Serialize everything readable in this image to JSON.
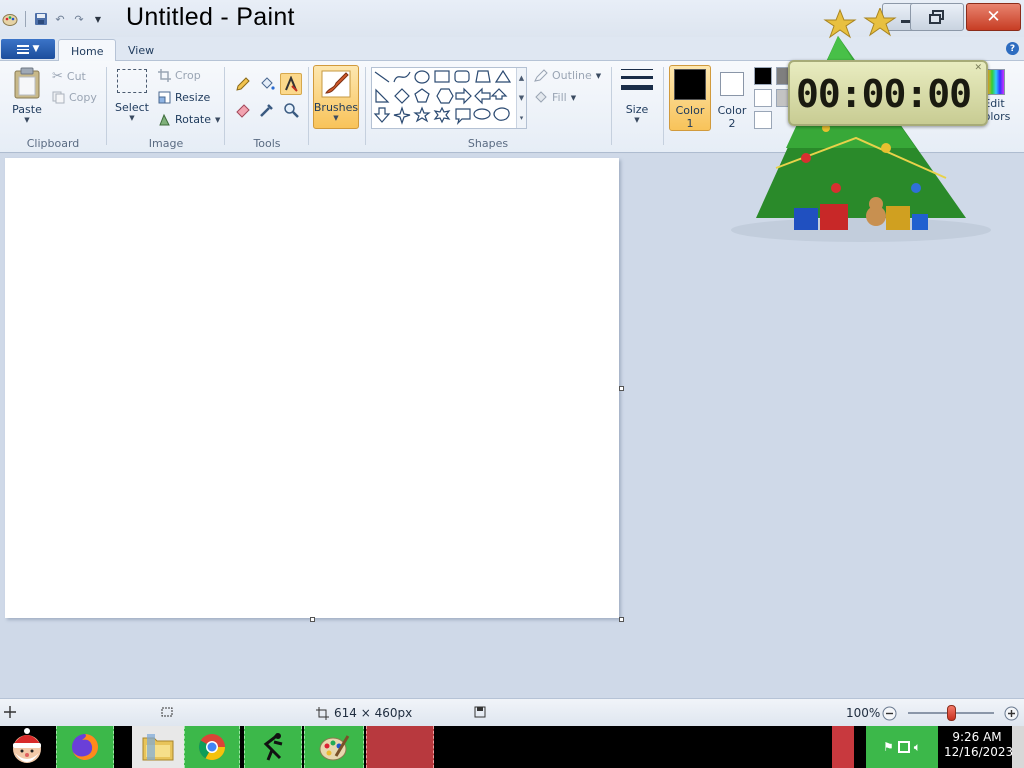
{
  "window": {
    "title": "Untitled - Paint"
  },
  "tabs": [
    {
      "label": "Home"
    },
    {
      "label": "View"
    }
  ],
  "clipboard": {
    "paste": "Paste",
    "cut": "Cut",
    "copy": "Copy",
    "group": "Clipboard"
  },
  "image": {
    "select": "Select",
    "crop": "Crop",
    "resize": "Resize",
    "rotate": "Rotate",
    "group": "Image"
  },
  "tools": {
    "group": "Tools"
  },
  "brushes": {
    "label": "Brushes"
  },
  "shapes": {
    "outline": "Outline",
    "fill": "Fill",
    "group": "Shapes"
  },
  "size": {
    "label": "Size"
  },
  "colors": {
    "color1_line1": "Color",
    "color1_line2": "1",
    "color2_line1": "Color",
    "color2_line2": "2",
    "edit_line1": "Edit",
    "edit_line2": "colors",
    "color1_value": "#000000",
    "color2_value": "#ffffff"
  },
  "timer_gadget": {
    "display": "00:00:00"
  },
  "status": {
    "dimensions": "614 × 460px",
    "zoom": "100%",
    "zoom_level": 100
  },
  "taskbar": {
    "clock_time": "9:26 AM",
    "clock_date": "12/16/2023"
  }
}
